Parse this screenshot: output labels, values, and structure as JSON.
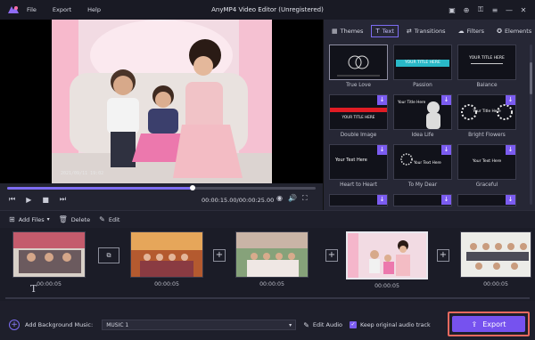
{
  "app": {
    "title": "AnyMP4 Video Editor (Unregistered)"
  },
  "menu": [
    "File",
    "Export",
    "Help"
  ],
  "window_controls": [
    "save-icon",
    "cart-icon",
    "key-icon",
    "menu-icon",
    "minimize-icon",
    "close-icon"
  ],
  "preview": {
    "timestamp": "2021/09/11 19:02"
  },
  "player": {
    "progress": 0.6,
    "current_time": "00:00:15.00",
    "total_time": "00:00:25.00",
    "time_display": "00:00:15.00/00:00:25.00"
  },
  "tabs": [
    {
      "label": "Themes",
      "icon": "themes-icon",
      "active": false
    },
    {
      "label": "Text",
      "icon": "text-icon",
      "active": true
    },
    {
      "label": "Transitions",
      "icon": "transitions-icon",
      "active": false
    },
    {
      "label": "Filters",
      "icon": "filters-icon",
      "active": false
    },
    {
      "label": "Elements",
      "icon": "elements-icon",
      "active": false
    }
  ],
  "text_templates": [
    {
      "label": "True Love",
      "caption": "",
      "download": false
    },
    {
      "label": "Passion",
      "caption": "YOUR TITLE HERE",
      "download": false
    },
    {
      "label": "Balance",
      "caption": "YOUR TITLE HERE",
      "download": false
    },
    {
      "label": "Double Image",
      "caption": "YOUR TITLE HERE",
      "download": true
    },
    {
      "label": "Idea Life",
      "caption": "Your Title Here",
      "download": true
    },
    {
      "label": "Bright Flowers",
      "caption": "Your Title Here",
      "download": true
    },
    {
      "label": "Heart to Heart",
      "caption": "Your Text Here",
      "download": true
    },
    {
      "label": "To My Dear",
      "caption": "Your Text Here",
      "download": true
    },
    {
      "label": "Graceful",
      "caption": "Your Text Here",
      "download": true
    }
  ],
  "edit_toolbar": {
    "add_files": "Add Files",
    "delete": "Delete",
    "edit": "Edit"
  },
  "timeline": {
    "clips": [
      {
        "duration": "00:00:05",
        "selected": false
      },
      {
        "duration": "00:00:05",
        "selected": false
      },
      {
        "duration": "00:00:05",
        "selected": false
      },
      {
        "duration": "00:00:05",
        "selected": true
      },
      {
        "duration": "00:00:05",
        "selected": false
      }
    ]
  },
  "bottom": {
    "add_background_music": "Add Background Music:",
    "music_value": "MUSIC 1",
    "edit_audio": "Edit Audio",
    "keep_original": "Keep original audio track",
    "export": "Export"
  },
  "colors": {
    "accent": "#7652ef",
    "export_highlight": "#e8695f"
  }
}
